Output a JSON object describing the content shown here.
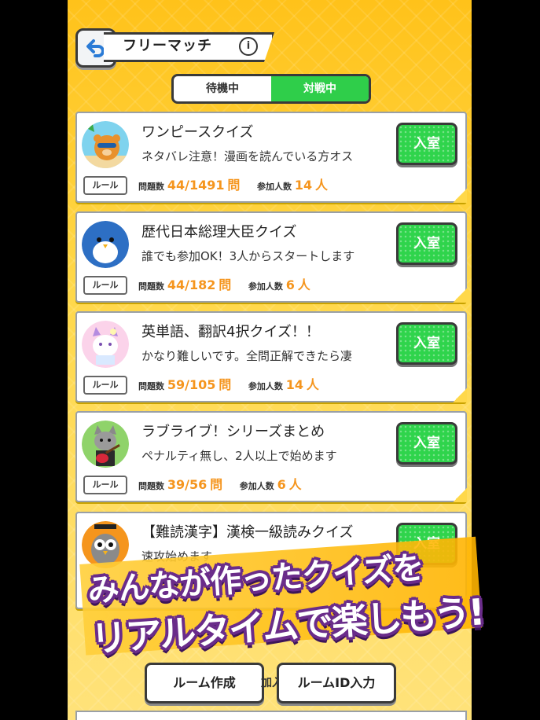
{
  "header": {
    "title": "フリーマッチ",
    "info_icon_glyph": "i"
  },
  "tabs": [
    {
      "label": "待機中",
      "active": false
    },
    {
      "label": "対戦中",
      "active": true
    }
  ],
  "stats_labels": {
    "questions": "問題数",
    "questions_unit": "問",
    "participants": "参加人数",
    "participants_unit": "人"
  },
  "rooms": [
    {
      "title": "ワンピースクイズ",
      "description": "ネタバレ注意！漫画を読んでいる方オス",
      "join_label": "入室",
      "rule_label": "ルール",
      "questions": "44/1491",
      "participants": "14",
      "avatar": "bear-sunglasses-avatar"
    },
    {
      "title": "歴代日本総理大臣クイズ",
      "description": "誰でも参加OK！3人からスタートします",
      "join_label": "入室",
      "rule_label": "ルール",
      "questions": "44/182",
      "participants": "6",
      "avatar": "penguin-avatar"
    },
    {
      "title": "英単語、翻訳4択クイズ！！",
      "description": "かなり難しいです。全問正解できたら凄",
      "join_label": "入室",
      "rule_label": "ルール",
      "questions": "59/105",
      "participants": "14",
      "avatar": "cat-flower-avatar"
    },
    {
      "title": "ラブライブ！シリーズまとめ",
      "description": "ペナルティ無し、2人以上で始めます",
      "join_label": "入室",
      "rule_label": "ルール",
      "questions": "39/56",
      "participants": "6",
      "avatar": "cat-guitar-avatar"
    },
    {
      "title": "【難読漢字】漢検一級読みクイズ",
      "description": "速攻始めます",
      "join_label": "入室",
      "avatar": "owl-graduate-avatar"
    }
  ],
  "bottom_buttons": {
    "create_room": "ルーム作成",
    "partial_label": "加入",
    "room_id_input": "ルームID入力"
  },
  "banner": {
    "line1": "みんなが作ったクイズを",
    "line2": "リアルタイムで楽しもう!"
  },
  "colors": {
    "accent_green": "#2fd44c",
    "number_orange": "#f5951d",
    "background_yellow": "#ffc21a",
    "banner_outline": "#6a2c8a"
  }
}
